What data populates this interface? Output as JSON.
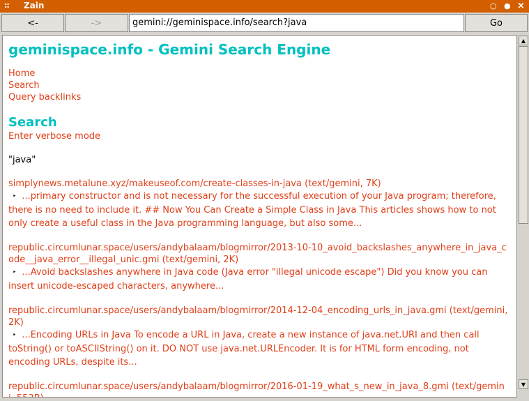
{
  "window": {
    "grip": "::",
    "title": "Zain",
    "buttons": {
      "minimize": "○",
      "maximize": "●",
      "close": "×"
    }
  },
  "toolbar": {
    "back_label": "<-",
    "forward_label": "->",
    "url": "gemini://geminispace.info/search?java",
    "go_label": "Go"
  },
  "page": {
    "title": "geminispace.info - Gemini Search Engine",
    "nav_links": [
      "Home",
      "Search",
      "Query backlinks"
    ],
    "section_heading": "Search",
    "verbose_link": "Enter verbose mode",
    "query": "\"java\"",
    "bullet": "‣",
    "results": [
      {
        "link": "simplynews.metalune.xyz/makeuseof.com/create-classes-in-java (text/gemini, 7K)",
        "snippet": "...primary constructor and is not necessary for the successful execution of your Java program; therefore, there is no need to include it. ## Now You Can Create a Simple Class in Java This articles shows how to not only create a useful class in the Java programming language, but also some..."
      },
      {
        "link": "republic.circumlunar.space/users/andybalaam/blogmirror/2013-10-10_avoid_backslashes_anywhere_in_java_code__java_error__illegal_unic.gmi (text/gemini, 2K)",
        "snippet": "...Avoid backslashes anywhere in Java code (Java error \"illegal unicode escape\") Did you know you can insert unicode-escaped characters, anywhere..."
      },
      {
        "link": "republic.circumlunar.space/users/andybalaam/blogmirror/2014-12-04_encoding_urls_in_java.gmi (text/gemini, 2K)",
        "snippet": "...Encoding URLs in Java To encode a URL in Java, create a new instance of java.net.URI and then call toString() or toASCIIString() on it. DO NOT use java.net.URLEncoder. It is for HTML form encoding, not encoding URLs, despite its..."
      },
      {
        "link": "republic.circumlunar.space/users/andybalaam/blogmirror/2016-01-19_what_s_new_in_java_8.gmi (text/gemini, 553B)",
        "snippet": ""
      }
    ]
  },
  "scrollbar": {
    "up_icon": "▲",
    "down_icon": "▼",
    "position": 0.0,
    "visible_fraction": 0.5
  },
  "colors": {
    "titlebar": "#d35f00",
    "heading": "#00c0c0",
    "link": "#e0401a",
    "chrome": "#d6d3ce"
  }
}
